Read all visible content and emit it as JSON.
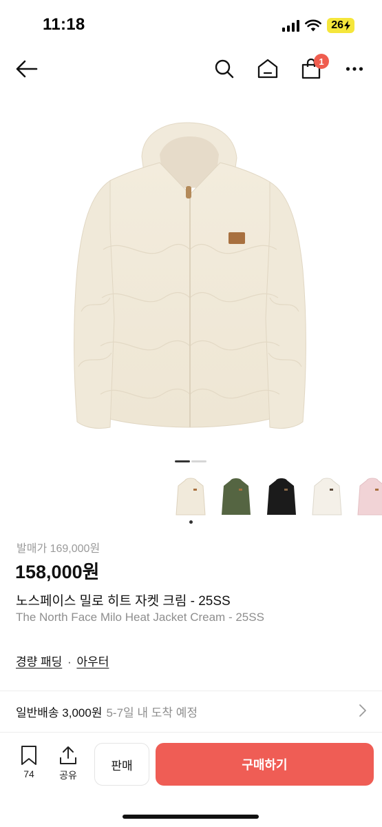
{
  "status_bar": {
    "time": "11:18",
    "battery": "26"
  },
  "nav": {
    "cart_count": "1"
  },
  "gallery": {
    "current_index": 1,
    "total": 2
  },
  "colors": {
    "accent": "#ef5d55",
    "badge": "#ef5d4f",
    "variants": [
      "cream",
      "khaki",
      "black",
      "ivory",
      "pink"
    ]
  },
  "product": {
    "original_price": "발매가 169,000원",
    "price": "158,000원",
    "title_ko": "노스페이스 밀로 히트 자켓 크림 - 25SS",
    "title_en": "The North Face Milo Heat Jacket Cream - 25SS",
    "category_1": "경량 패딩",
    "category_sep": "·",
    "category_2": "아우터"
  },
  "shipping": {
    "label": "일반배송 3,000원",
    "eta": "5-7일 내 도착 예정"
  },
  "bottom_bar": {
    "bookmark_count": "74",
    "share_label": "공유",
    "sell_label": "판매",
    "buy_label": "구매하기"
  }
}
